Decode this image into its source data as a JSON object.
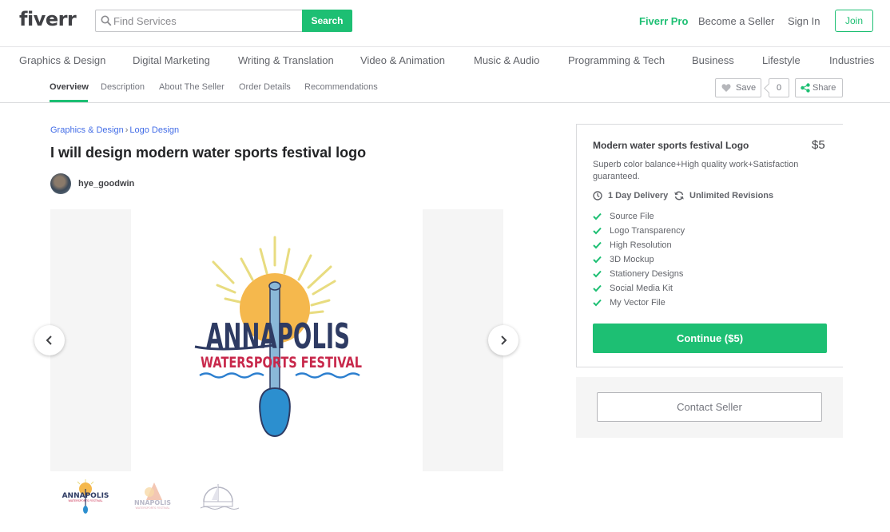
{
  "header": {
    "logo": "fiverr",
    "search_placeholder": "Find Services",
    "search_button": "Search",
    "fiverr_pro": "Fiverr Pro",
    "become_seller": "Become a Seller",
    "sign_in": "Sign In",
    "join": "Join"
  },
  "categories": [
    "Graphics & Design",
    "Digital Marketing",
    "Writing & Translation",
    "Video & Animation",
    "Music & Audio",
    "Programming & Tech",
    "Business",
    "Lifestyle",
    "Industries"
  ],
  "subnav": {
    "tabs": [
      "Overview",
      "Description",
      "About The Seller",
      "Order Details",
      "Recommendations"
    ],
    "active_tab": "Overview",
    "save_label": "Save",
    "save_count": "0",
    "share_label": "Share"
  },
  "breadcrumb": [
    "Graphics & Design",
    "Logo Design"
  ],
  "breadcrumb_separator": "›",
  "gig": {
    "title": "I will design modern water sports festival logo",
    "seller_name": "hye_goodwin"
  },
  "artwork": {
    "line1": "ANNAPOLIS",
    "line2": "WATERSPORTS FESTIVAL",
    "thumb_line1": "NNAPOLIS",
    "thumb_line2": "WATERSPORTS FESTIVAL",
    "colors": {
      "navy": "#2e3b63",
      "red": "#c8284b",
      "sun": "#f5b84d",
      "rays": "#e8dc80",
      "paddle": "#2c8fcf",
      "water": "#2c7fcf"
    }
  },
  "package": {
    "title": "Modern water sports festival Logo",
    "price": "$5",
    "description": "Superb color balance+High quality work+Satisfaction guaranteed.",
    "delivery": "1 Day Delivery",
    "revisions": "Unlimited Revisions",
    "features": [
      "Source File",
      "Logo Transparency",
      "High Resolution",
      "3D Mockup",
      "Stationery Designs",
      "Social Media Kit",
      "My Vector File"
    ],
    "continue_label": "Continue ($5)",
    "contact_label": "Contact Seller"
  },
  "colors": {
    "brand_green": "#1dbf73",
    "link_blue": "#446ee7",
    "text_dark": "#404145"
  }
}
